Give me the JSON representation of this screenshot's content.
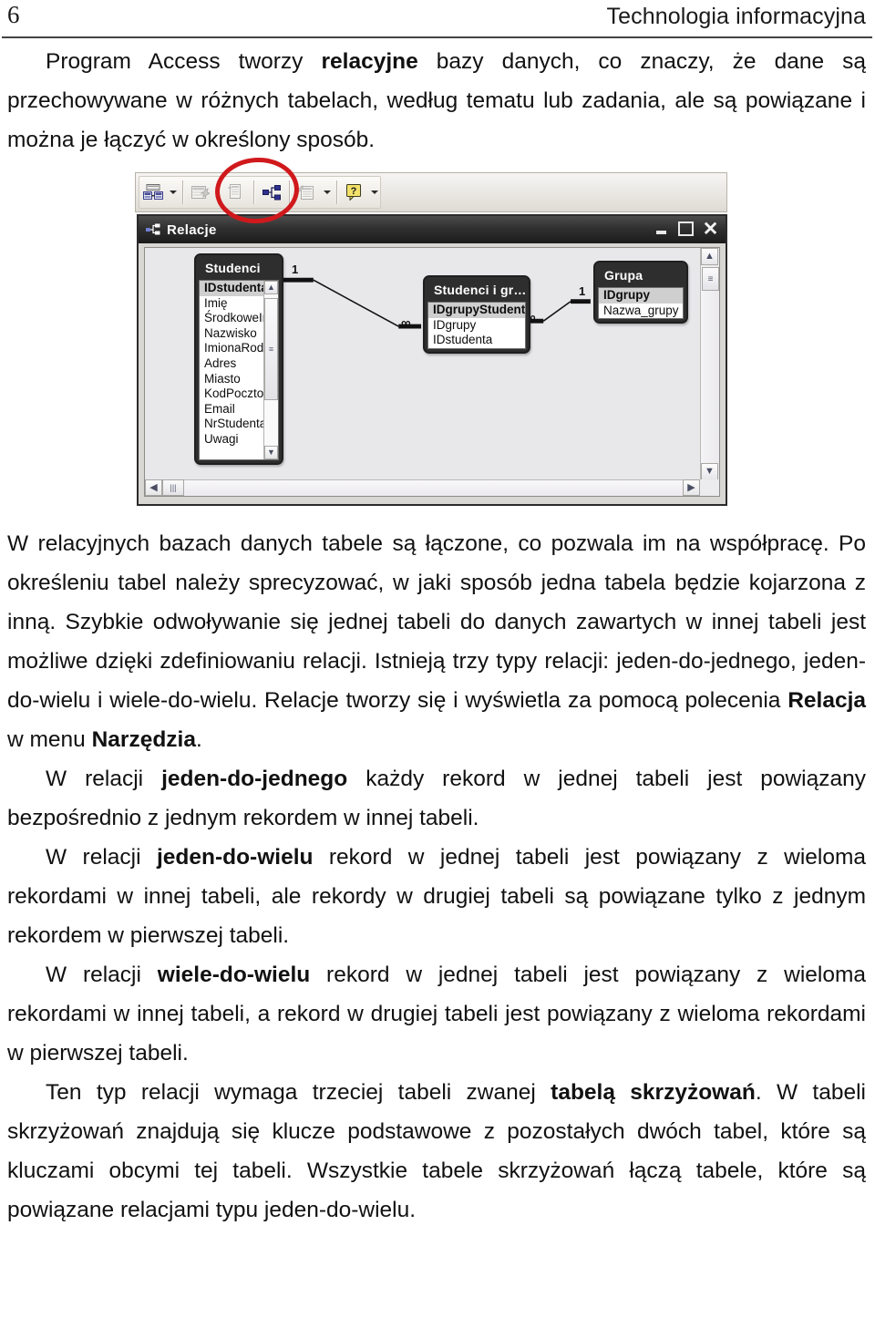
{
  "header": {
    "page_number": "6",
    "running_title": "Technologia informacyjna"
  },
  "body": {
    "paragraph_1_parts": {
      "a": "Program Access tworzy ",
      "b_bold": "relacyjne",
      "c": " bazy danych, co znaczy, że dane są przechowywane w różnych tabelach, według tematu lub zadania, ale są powiązane i można je łączyć w określony sposób."
    },
    "paragraph_2_parts": {
      "a": "W relacyjnych bazach danych tabele są łączone, co pozwala im na współpracę. Po określeniu tabel należy sprecyzować, w jaki sposób jedna tabela będzie kojarzona z inną. Szybkie odwoływanie się jednej tabeli do danych zawartych w innej tabeli jest możliwe dzięki zdefiniowaniu relacji. Istnieją trzy typy relacji: jeden-do-jednego, jeden-do-wielu i wiele-do-wielu. Relacje tworzy się i wyświetla za pomocą polecenia ",
      "b_bold": "Relacja",
      "c": " w menu ",
      "d_bold": "Narzędzia",
      "e": "."
    },
    "paragraph_3_parts": {
      "a": "W relacji ",
      "b_bold": "jeden-do-jednego",
      "c": " każdy rekord w jednej tabeli jest powiązany bezpośrednio z jednym rekordem w innej tabeli."
    },
    "paragraph_4_parts": {
      "a": "W relacji ",
      "b_bold": "jeden-do-wielu",
      "c": " rekord w jednej tabeli jest powiązany z wieloma rekordami w innej tabeli, ale rekordy w drugiej tabeli są powiązane tylko z jednym rekordem w pierwszej tabeli."
    },
    "paragraph_5_parts": {
      "a": "W relacji ",
      "b_bold": "wiele-do-wielu",
      "c": " rekord w jednej tabeli jest powiązany z wieloma rekordami w innej tabeli, a rekord w drugiej tabeli jest powiązany z wieloma rekordami w pierwszej tabeli."
    },
    "paragraph_6_parts": {
      "a": "Ten typ relacji wymaga trzeciej tabeli zwanej ",
      "b_bold": "tabelą skrzyżowań",
      "c": ". W tabeli skrzyżowań znajdują się klucze podstawowe z pozostałych dwóch tabel, które są kluczami obcymi tej tabeli. Wszystkie tabele skrzyżowań łączą tabele, które są powiązane relacjami typu jeden-do-wielu."
    }
  },
  "screenshot": {
    "toolbar": {
      "buttons": [
        {
          "name": "relationships-view-icon",
          "has_dropdown": true,
          "enabled": true
        },
        {
          "name": "show-table-icon",
          "has_dropdown": false,
          "enabled": false
        },
        {
          "name": "clear-layout-icon",
          "has_dropdown": false,
          "enabled": false
        },
        {
          "name": "relationships-icon",
          "has_dropdown": false,
          "enabled": true
        },
        {
          "name": "new-object-icon",
          "has_dropdown": true,
          "enabled": false
        },
        {
          "name": "help-icon",
          "has_dropdown": true,
          "enabled": true
        }
      ]
    },
    "window": {
      "title": "Relacje",
      "minimize_label": "_",
      "maximize_label": "□",
      "close_label": "✕"
    },
    "tables": [
      {
        "name": "Studenci",
        "fields": [
          "IDstudenta",
          "Imię",
          "ŚrodkoweImię",
          "Nazwisko",
          "ImionaRodziców",
          "Adres",
          "Miasto",
          "KodPocztowy",
          "Email",
          "NrStudenta",
          "Uwagi"
        ],
        "primary_key": "IDstudenta",
        "has_scrollbar": true
      },
      {
        "name": "Studenci i gr…",
        "fields": [
          "IDgrupyStudenta",
          "IDgrupy",
          "IDstudenta"
        ],
        "primary_key": "IDgrupyStudenta",
        "has_scrollbar": false
      },
      {
        "name": "Grupa",
        "fields": [
          "IDgrupy",
          "Nazwa_grupy"
        ],
        "primary_key": "IDgrupy",
        "has_scrollbar": false
      }
    ],
    "relationships": [
      {
        "from": "Studenci",
        "to": "Studenci i gr…",
        "from_cardinality": "1",
        "to_cardinality": "∞"
      },
      {
        "from": "Grupa",
        "to": "Studenci i gr…",
        "from_cardinality": "1",
        "to_cardinality": "∞"
      }
    ],
    "annotation": {
      "shape": "ellipse",
      "color": "#d0191c",
      "targets": "relationships-icon"
    },
    "scrollbars": {
      "vertical": {
        "up": "▲",
        "down": "▼",
        "thumb": "≡"
      },
      "horizontal": {
        "left": "◀",
        "right": "▶",
        "thumb": "|||"
      }
    }
  }
}
